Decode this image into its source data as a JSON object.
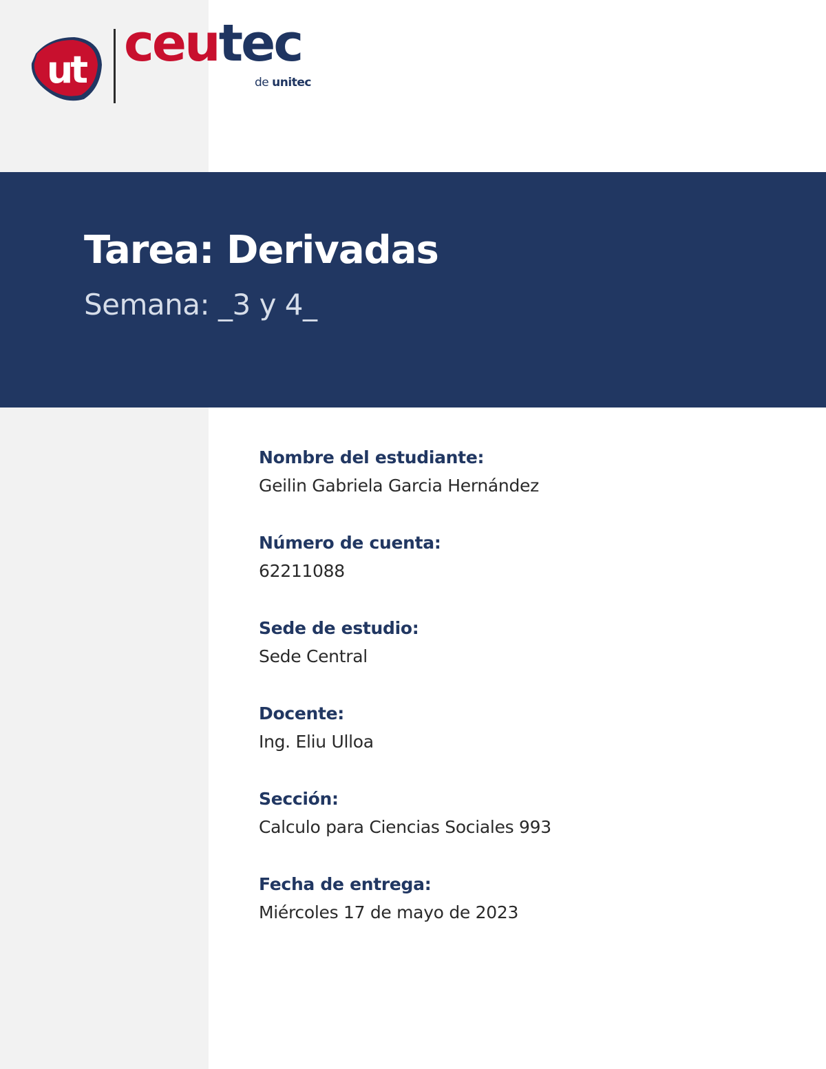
{
  "brand": {
    "logo_badge": "ut",
    "wordmark_red": "ceu",
    "wordmark_blue": "tec",
    "tagline_prefix": "de",
    "tagline_name": "unitec",
    "colors": {
      "red": "#c8102e",
      "navy": "#213762"
    }
  },
  "banner": {
    "title": "Tarea: Derivadas",
    "subtitle": "Semana: _3 y 4_"
  },
  "fields": [
    {
      "label": "Nombre del estudiante:",
      "value": "Geilin Gabriela Garcia Hernández"
    },
    {
      "label": "Número de cuenta:",
      "value": "62211088"
    },
    {
      "label": "Sede de estudio:",
      "value": "Sede Central"
    },
    {
      "label": "Docente:",
      "value": "Ing. Eliu Ulloa"
    },
    {
      "label": "Sección:",
      "value": "Calculo para Ciencias Sociales 993"
    },
    {
      "label": "Fecha de entrega:",
      "value": "Miércoles 17 de mayo de 2023"
    }
  ]
}
